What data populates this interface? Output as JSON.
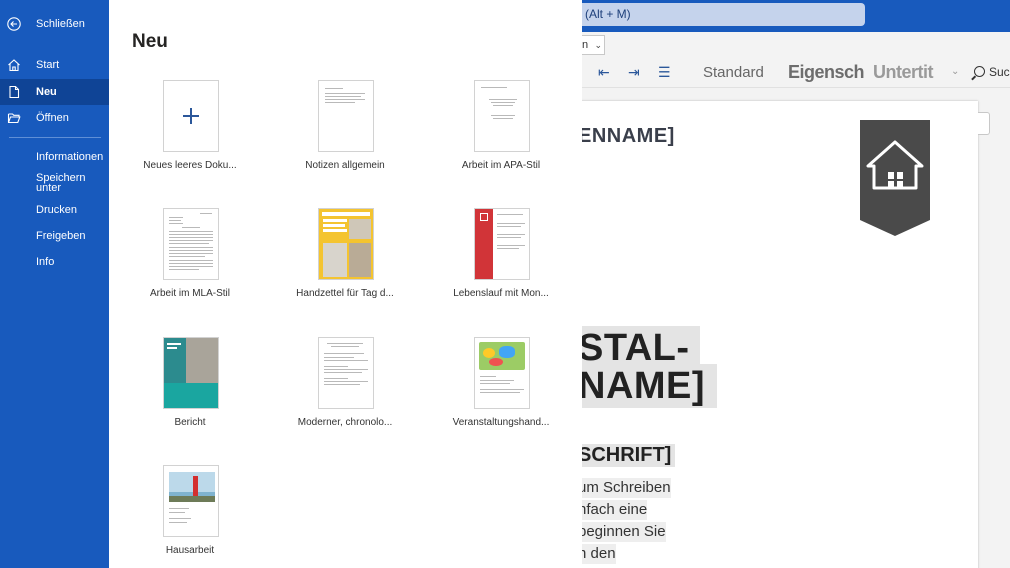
{
  "window": {
    "search_hint": "(Alt + M)",
    "font_size_partial": "n",
    "ribbon_styles": [
      "Standard",
      "Eigensch",
      "Untertit"
    ],
    "search_partial": "Suc"
  },
  "document": {
    "heading_partial": "ENNAME]",
    "title_line1": "STAL-",
    "title_line2": "NAME]",
    "subheading_partial": "SCHRIFT]",
    "body_lines": [
      "um Schreiben",
      "nfach eine",
      "beginnen Sie",
      "n den"
    ]
  },
  "nav": {
    "close": "Schließen",
    "start": "Start",
    "new": "Neu",
    "open": "Öffnen",
    "info": "Informationen",
    "save_as": "Speichern unter",
    "print": "Drucken",
    "share": "Freigeben",
    "about": "Info"
  },
  "panel": {
    "title": "Neu",
    "templates": [
      {
        "label": "Neues leeres Doku..."
      },
      {
        "label": "Notizen allgemein"
      },
      {
        "label": "Arbeit im APA-Stil"
      },
      {
        "label": "Arbeit im MLA-Stil"
      },
      {
        "label": "Handzettel für Tag d..."
      },
      {
        "label": "Lebenslauf mit Mon..."
      },
      {
        "label": "Bericht"
      },
      {
        "label": "Moderner, chronolo..."
      },
      {
        "label": "Veranstaltungshand..."
      },
      {
        "label": "Hausarbeit"
      }
    ]
  },
  "colors": {
    "brand_blue": "#185abd",
    "nav_active": "#0f4496"
  }
}
